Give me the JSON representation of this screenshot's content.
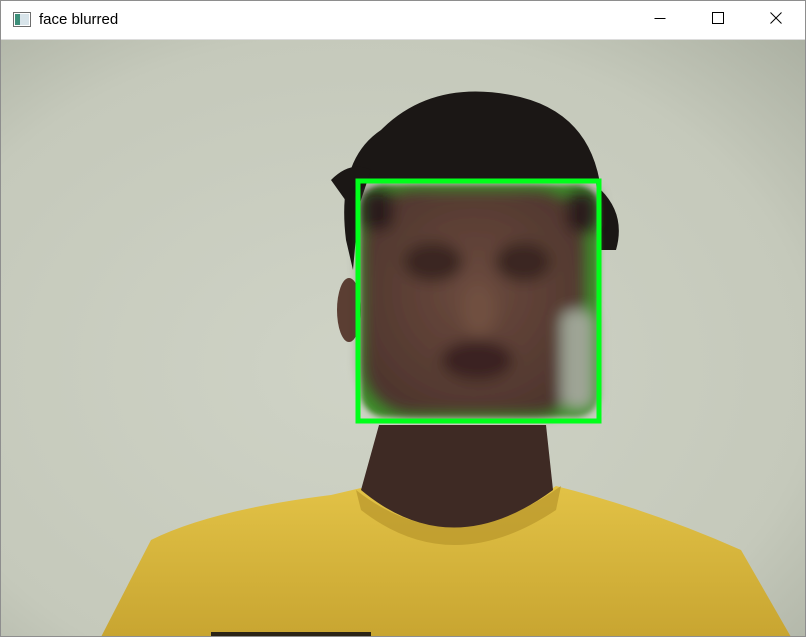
{
  "window": {
    "title": "face blurred",
    "icon": "opencv-window-icon",
    "controls": {
      "minimize_icon": "minimize-icon",
      "maximize_icon": "maximize-icon",
      "close_icon": "close-icon"
    }
  },
  "frame": {
    "detection_box_color": "#00ff1a",
    "wall_color": "#c9cdc0",
    "shirt_color": "#d9b63c",
    "hair_color": "#1a1614",
    "skin_color": "#5a3d33"
  }
}
